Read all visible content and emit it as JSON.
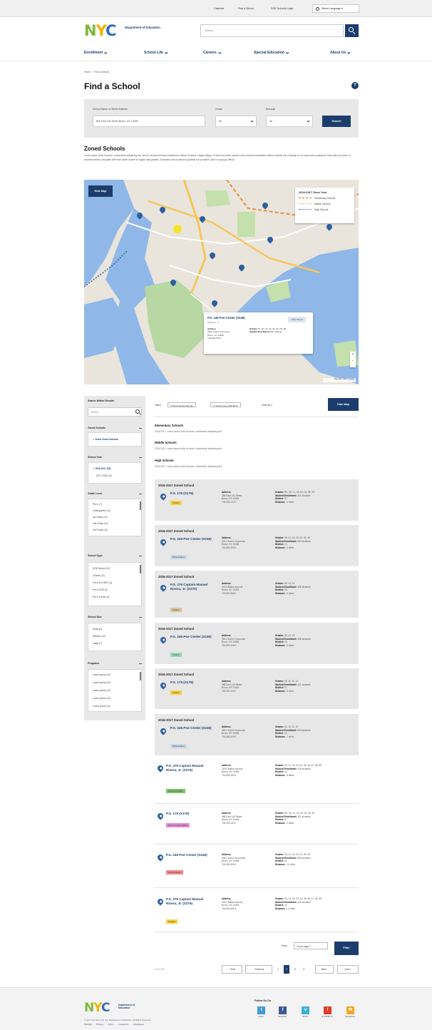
{
  "util": {
    "links": [
      "Calendar",
      "Find a School",
      "DOE Schools Login"
    ],
    "language": "Select Language"
  },
  "logo": {
    "dept": "Department of Education"
  },
  "search": {
    "placeholder": "Search..."
  },
  "nav": [
    "Enrollment",
    "School Life",
    "Careers",
    "Special Education",
    "About Us"
  ],
  "breadcrumb": [
    "Home",
    "Find a School"
  ],
  "page_title": "Find a School",
  "filters": {
    "address_label": "School Name or Street Address",
    "address_value": "890 East 150 Street Bronx, NY 10455",
    "grade_label": "Grade",
    "grade_value": "All",
    "borough_label": "Borough",
    "borough_value": "All",
    "search_label": "Search"
  },
  "zoned": {
    "title": "Zoned Schools",
    "body": "Lorem ipsum dolor sit amet, consectetur adipiscing elit, sed do eiusmod tempor incididunt ut labore et dolore magna aliqua. Ut enim ad minim veniam, quis nostrud exercitation ullamco laboris nisi ut aliquip ex ea commodo consequat. Duis aute irure dolor in reprehenderit in voluptate velit esse cillum dolore eu fugiat nulla pariatur. Excepteur sint occaecat cupidatat non proident, sunt in culpa qui officia."
  },
  "map": {
    "hide_label": "Hide Map",
    "legend_title": "2016-2017 Zone Year",
    "legend": [
      "Elementary Schools",
      "Middle Schools",
      "High Schools"
    ],
    "popup": {
      "name": "P.S. 246 Poe Center (X246)",
      "dist": "Distance: .4",
      "badge": "DOE School",
      "addr_label": "Address",
      "addr": [
        "2641 Grand Concourse",
        "Bronx, NY 10468",
        "718-584-6764"
      ],
      "grades_label": "Grades",
      "grades": "PK, 0K, 01, 02, 03, 04, 05, SE",
      "enroll_label": "Student Enrollment",
      "enroll": "554 students"
    },
    "attribution": "Map data ©2017 Google"
  },
  "sidebar": {
    "search_title": "Search Within Results",
    "search_placeholder": "Search...",
    "zoned_title": "Zoned Schools",
    "zoned_option": "Show Zoned Schools",
    "year_title": "School Year",
    "years": [
      "2016-2017 (24)",
      "2017-2018 (12)"
    ],
    "grade_title": "Grade Level",
    "grades": [
      "Pre-K (7)",
      "Kindergarten (12)",
      "1st Grade (12)",
      "2nd Grade (12)",
      "3rd Grade (12)"
    ],
    "type_title": "School Type",
    "types": [
      "DOE School (12)",
      "Charter (12)",
      "Pre-K NYCEEC (3)",
      "Pre-K DOE (5)",
      "Pre-K Center (4)"
    ],
    "size_title": "School Size",
    "sizes": [
      "Small (5)",
      "Medium (12)",
      "Large (7)"
    ],
    "programs_title": "Programs",
    "programs": [
      "Lorem ipsum (12)",
      "Lorem ipsum (12)",
      "Lorem ipsum (12)",
      "Lorem ipsum (12)",
      "Lorem ipsum (12)"
    ]
  },
  "results": {
    "filters_label": "Filters",
    "chips": [
      "Show Zoned Schools",
      "School Year 2016-2017"
    ],
    "clear": "Clear All",
    "hide_map": "Hide Map",
    "levels": [
      {
        "title": "Elementary Schools",
        "desc": "2016-2017. Lorem ipsum dolor sit amet, consectetur adipiscing elit."
      },
      {
        "title": "Middle Schools",
        "desc": "2016-2017. Lorem ipsum dolor sit amet, consectetur adipiscing elit."
      },
      {
        "title": "High Schools",
        "desc": "2016-2017. Lorem ipsum dolor sit amet, consectetur adipiscing elit."
      }
    ],
    "zoned_heading": "2016-2017 Zoned School",
    "address_label": "Address",
    "grades_label": "Grades:",
    "enroll_label": "Student Enrollment:",
    "district_label": "District:",
    "distance_label": "Distance:",
    "cards": [
      {
        "name": "P.S. 179 (X179)",
        "tag": "Charter",
        "tag_color": "#f5cf3c",
        "addr": [
          "468 East 140 Street",
          "Bronx, NY 10454",
          "718-292-2237"
        ],
        "grades": "PK, 0K, 01, 02, 03, 04, 05, SE",
        "enroll": "341 students",
        "district": "07",
        "distance": ".2 miles"
      },
      {
        "name": "P.S. 246 Poe Center (X246)",
        "tag": "DOE School",
        "tag_color": "#c7d6ea",
        "addr": [
          "2641 Grand Concourse",
          "Bronx, NY 10468",
          "718-584-6764"
        ],
        "grades": "0K, 01, 02, 03, 04, 05, SE",
        "enroll": "554 students",
        "district": "10",
        "distance": ".4 miles"
      },
      {
        "name": "P.S. 279 Captain Manuel Rivera, Jr. (X279)",
        "tag": "Charter",
        "tag_color": "#d8c39a",
        "addr": [
          "2100 Walton Avenue",
          "Bronx, NY 10453",
          "718-584-6004"
        ],
        "grades": "0K, 01, 02",
        "enroll": "426 students",
        "district": "10",
        "distance": ".5 miles"
      },
      {
        "name": "P.S. 246 Poe Center (X246)",
        "tag": "Charter",
        "tag_color": "#9ad9b5",
        "addr": [
          "2641 Grand Concourse",
          "Bronx, NY 10468",
          "718-584-6764"
        ],
        "grades": "0K, 01, 02",
        "enroll": "456 students",
        "district": "10",
        "distance": ".6 miles"
      },
      {
        "name": "P.S. 179 (X179)",
        "tag": "Charter",
        "tag_color": "#f5cf3c",
        "addr": [
          "468 East 140 Street",
          "Bronx, NY 10454",
          "718-292-2237"
        ],
        "grades": "09, 10, 11, 12",
        "enroll": "341 students",
        "district": "07",
        "distance": ".6 miles"
      },
      {
        "name": "P.S. 246 Poe Center (X246)",
        "tag": "DOE School",
        "tag_color": "#c7d6ea",
        "addr": [
          "2641 Grand Concourse",
          "Bronx, NY 10468",
          "718-584-6764"
        ],
        "grades": "09, 10, 11, 12",
        "enroll": "554 students",
        "district": "10",
        "distance": ".7 miles"
      },
      {
        "name": "P.S. 279 Captain Manuel Rivera, Jr. (X279)",
        "tag": "Pre-K NYCEEC",
        "tag_color": "#7cc46a",
        "addr": [
          "2100 Walton Avenue",
          "Bronx, NY 10453",
          "718-584-6004"
        ],
        "grades": "0K, 01, 02, 03, 04, 05, 06, 07, 08, SE",
        "enroll": "426 students",
        "district": "10",
        "distance": ".8 miles"
      },
      {
        "name": "P.S. 179 (X179)",
        "tag": "Pre-K Center (DOE)",
        "tag_color": "#e58ad3",
        "addr": [
          "468 East 140 Street",
          "Bronx, NY 10454",
          "718-292-2237"
        ],
        "grades": "PK, 0K, 01, 02, 03, 04, 05, SE",
        "enroll": "341 students",
        "district": "07",
        "distance": ".9 miles"
      },
      {
        "name": "P.S. 246 Poe Center (X246)",
        "tag": "Pre-K Center",
        "tag_color": "#f08a8a",
        "addr": [
          "2641 Grand Concourse",
          "Bronx, NY 10468",
          "718-584-6764"
        ],
        "grades": "0K, 01, 02, 03, 04, 05, SE",
        "enroll": "554 students",
        "district": "10",
        "distance": "1.1 miles"
      },
      {
        "name": "P.S. 279 Captain Manuel Rivera, Jr. (X279)",
        "tag": "Charter",
        "tag_color": "#f5cf3c",
        "addr": [
          "2100 Walton Avenue",
          "Bronx, NY 10453",
          "718-584-6004"
        ],
        "grades": "0K, 01, 02, 03, 04, 05, 06, 07, 08, SE",
        "enroll": "426 students",
        "district": "10",
        "distance": "1.2 miles"
      }
    ],
    "show_label": "Show",
    "show_value": "10 per page",
    "filter_label": "Filter",
    "count": "10 of 134",
    "pager": {
      "first": "« First",
      "prev": "‹ Previous",
      "pages": [
        "1",
        "2",
        "3",
        "4"
      ],
      "next": "Next ›",
      "last": "Last »"
    }
  },
  "footer": {
    "dept": "Department of Education",
    "copyright": "© 2017 The New York City Department of Education. All Rights Reserved.",
    "links": [
      "Sitemap",
      "Privacy",
      "Terms",
      "Contact Us",
      "Employees"
    ],
    "follow": "Follow Us On",
    "social": [
      {
        "name": "Twitter",
        "color": "#3f9ad6",
        "glyph": "t"
      },
      {
        "name": "Facebook",
        "color": "#3b5998",
        "glyph": "f"
      },
      {
        "name": "Vimeo",
        "color": "#38b2d6",
        "glyph": "v"
      },
      {
        "name": "NYCDOE TV",
        "color": "#e03c2d",
        "glyph": "!"
      },
      {
        "name": "Newsletters",
        "color": "#f5a623",
        "glyph": "✉"
      }
    ]
  }
}
